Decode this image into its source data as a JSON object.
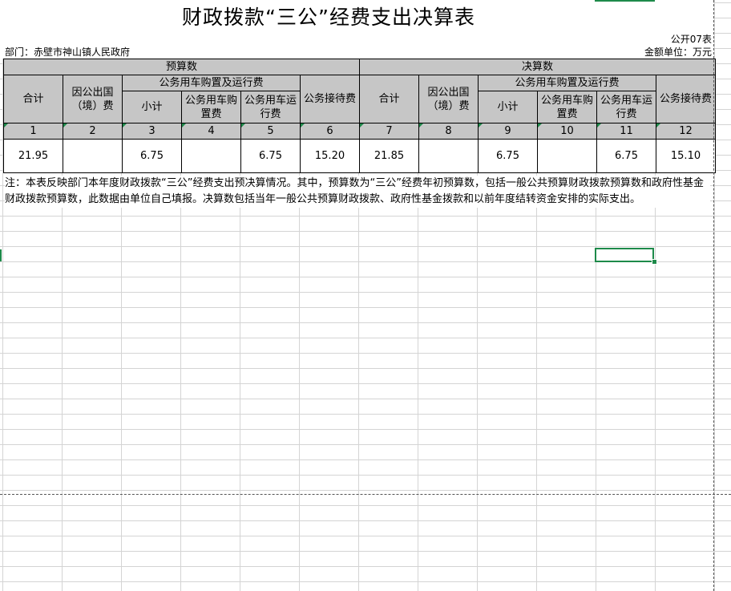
{
  "title": "财政拨款“三公”经费支出决算表",
  "form_code": "公开07表",
  "department": "部门：赤壁市神山镇人民政府",
  "unit": "金额单位：万元",
  "headers": {
    "budget": "预算数",
    "final": "决算数",
    "total": "合计",
    "abroad": "因公出国（境）费",
    "vehicle": "公务用车购置及运行费",
    "subtotal": "小计",
    "vehicle_purchase": "公务用车购置费",
    "vehicle_operation": "公务用车运行费",
    "reception": "公务接待费"
  },
  "index_row": [
    "1",
    "2",
    "3",
    "4",
    "5",
    "6",
    "7",
    "8",
    "9",
    "10",
    "11",
    "12"
  ],
  "data_row": [
    "21.95",
    "",
    "6.75",
    "",
    "6.75",
    "15.20",
    "21.85",
    "",
    "6.75",
    "",
    "6.75",
    "15.10"
  ],
  "note": "注：本表反映部门本年度财政拨款“三公”经费支出预决算情况。其中，预算数为“三公”经费年初预算数，包括一般公共预算财政拨款预算数和政府性基金财政拨款预算数，此数据由单位自己填报。决算数包括当年一般公共预算财政拨款、政府性基金拨款和以前年度结转资金安排的实际支出。"
}
